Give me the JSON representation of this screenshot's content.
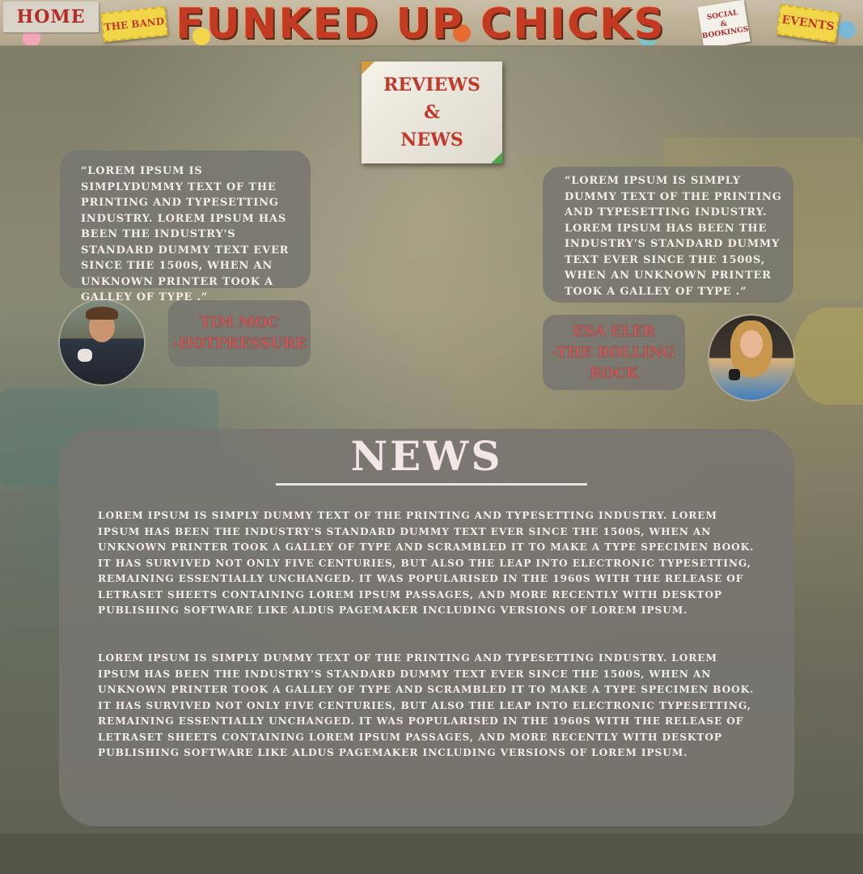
{
  "nav": {
    "home": "HOME",
    "band": "THE BAND",
    "title": "FUNKED UP CHICKS",
    "social": [
      "SOCIAL",
      "&",
      "BOOKINGS"
    ],
    "events": "EVENTS"
  },
  "reviews_header": [
    "REVIEWS",
    "&",
    "NEWS"
  ],
  "reviews": [
    {
      "quote": "“LOREM IPSUM IS SIMPLYDUMMY TEXT OF THE PRINTING AND TYPESETTING INDUSTRY. LOREM IPSUM HAS BEEN THE INDUSTRY'S STANDARD DUMMY TEXT EVER SINCE THE 1500S, WHEN AN UNKNOWN PRINTER TOOK A GALLEY OF TYPE .”",
      "author_line1": "TIM MOC",
      "author_line2": "-HOTPRESSURE",
      "avatar": "avatar-man"
    },
    {
      "quote": "“LOREM IPSUM IS SIMPLY DUMMY TEXT OF THE PRINTING AND TYPESETTING INDUSTRY. LOREM IPSUM HAS BEEN THE INDUSTRY'S STANDARD DUMMY TEXT EVER SINCE THE 1500S, WHEN AN UNKNOWN PRINTER TOOK A GALLEY OF TYPE .”",
      "author_line1": "ESA ELER",
      "author_line2": "-THE ROLLING",
      "author_line3": "ROCK",
      "avatar": "avatar-woman"
    }
  ],
  "news": {
    "title": "NEWS",
    "paragraphs": [
      "LOREM IPSUM IS SIMPLY DUMMY TEXT OF THE PRINTING AND TYPESETTING INDUSTRY. LOREM IPSUM HAS BEEN THE INDUSTRY'S STANDARD DUMMY TEXT EVER SINCE THE 1500S, WHEN AN UNKNOWN PRINTER TOOK A GALLEY OF TYPE AND SCRAMBLED IT TO MAKE A TYPE SPECIMEN BOOK. IT HAS SURVIVED NOT ONLY FIVE CENTURIES, BUT ALSO THE LEAP INTO ELECTRONIC TYPESETTING, REMAINING ESSENTIALLY UNCHANGED. IT WAS POPULARISED IN THE 1960S WITH THE RELEASE OF LETRASET SHEETS CONTAINING LOREM IPSUM PASSAGES, AND MORE RECENTLY WITH DESKTOP PUBLISHING SOFTWARE LIKE ALDUS PAGEMAKER INCLUDING VERSIONS OF LOREM IPSUM.",
      "LOREM IPSUM IS SIMPLY DUMMY TEXT OF THE PRINTING AND TYPESETTING INDUSTRY. LOREM IPSUM HAS BEEN THE INDUSTRY'S STANDARD DUMMY TEXT EVER SINCE THE 1500S, WHEN AN UNKNOWN PRINTER TOOK A GALLEY OF TYPE AND SCRAMBLED IT TO MAKE A TYPE SPECIMEN BOOK. IT HAS SURVIVED NOT ONLY FIVE CENTURIES, BUT ALSO THE LEAP INTO ELECTRONIC TYPESETTING, REMAINING ESSENTIALLY UNCHANGED. IT WAS POPULARISED IN THE 1960S WITH THE RELEASE OF LETRASET SHEETS CONTAINING LOREM IPSUM PASSAGES, AND MORE RECENTLY WITH DESKTOP PUBLISHING SOFTWARE LIKE ALDUS PAGEMAKER INCLUDING VERSIONS OF LOREM IPSUM."
    ]
  },
  "colors": {
    "accent_red": "#c0392b",
    "ticket_yellow": "#f2d64a",
    "panel_grey": "#787670",
    "text_light": "#f4ece8"
  }
}
